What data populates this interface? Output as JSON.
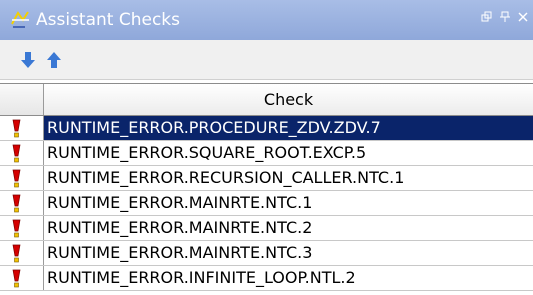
{
  "window": {
    "title": "Assistant Checks",
    "title_icon": "assistant-icon",
    "controls": [
      "float-icon",
      "pin-icon",
      "close-icon"
    ]
  },
  "toolbar": {
    "buttons": [
      {
        "icon": "arrow-down-icon",
        "color": "#3a78d4"
      },
      {
        "icon": "arrow-up-icon",
        "color": "#3a78d4"
      }
    ]
  },
  "grid": {
    "columns": [
      "",
      "Check"
    ],
    "rows": [
      {
        "check": "RUNTIME_ERROR.PROCEDURE_ZDV.ZDV.7",
        "icon": "exclamation-icon",
        "selected": true
      },
      {
        "check": "RUNTIME_ERROR.SQUARE_ROOT.EXCP.5",
        "icon": "exclamation-icon",
        "selected": false
      },
      {
        "check": "RUNTIME_ERROR.RECURSION_CALLER.NTC.1",
        "icon": "exclamation-icon",
        "selected": false
      },
      {
        "check": "RUNTIME_ERROR.MAINRTE.NTC.1",
        "icon": "exclamation-icon",
        "selected": false
      },
      {
        "check": "RUNTIME_ERROR.MAINRTE.NTC.2",
        "icon": "exclamation-icon",
        "selected": false
      },
      {
        "check": "RUNTIME_ERROR.MAINRTE.NTC.3",
        "icon": "exclamation-icon",
        "selected": false
      },
      {
        "check": "RUNTIME_ERROR.INFINITE_LOOP.NTL.2",
        "icon": "exclamation-icon",
        "selected": false
      }
    ]
  },
  "colors": {
    "titlebar": "#98afe0",
    "selection": "#0a246a",
    "icon_red": "#d40000",
    "icon_yellow": "#f2c200"
  }
}
